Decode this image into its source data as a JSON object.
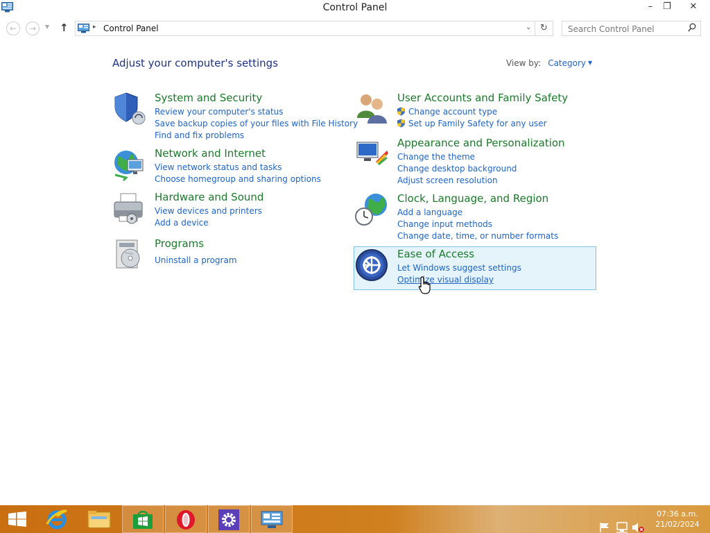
{
  "window": {
    "title": "Control Panel",
    "minimize": "–",
    "restore": "❐",
    "close": "✕"
  },
  "nav": {
    "back": "←",
    "forward": "→",
    "up": "↑",
    "breadcrumb_arrow": "▸",
    "breadcrumb": "Control Panel",
    "address_dropdown": "⌄",
    "refresh": "↻",
    "search_placeholder": "Search Control Panel"
  },
  "content": {
    "heading": "Adjust your computer's settings",
    "view_by_label": "View by:",
    "view_by_value": "Category",
    "categories": [
      {
        "title": "System and Security",
        "icon": "shield-icon",
        "links": [
          "Review your computer's status",
          "Save backup copies of your files with File History",
          "Find and fix problems"
        ]
      },
      {
        "title": "Network and Internet",
        "icon": "network-globe-icon",
        "links": [
          "View network status and tasks",
          "Choose homegroup and sharing options"
        ]
      },
      {
        "title": "Hardware and Sound",
        "icon": "printer-icon",
        "links": [
          "View devices and printers",
          "Add a device"
        ]
      },
      {
        "title": "Programs",
        "icon": "programs-disc-icon",
        "links": [
          "Uninstall a program"
        ]
      },
      {
        "title": "User Accounts and Family Safety",
        "icon": "users-icon",
        "links": [
          "Change account type",
          "Set up Family Safety for any user"
        ]
      },
      {
        "title": "Appearance and Personalization",
        "icon": "monitor-paint-icon",
        "links": [
          "Change the theme",
          "Change desktop background",
          "Adjust screen resolution"
        ]
      },
      {
        "title": "Clock, Language, and Region",
        "icon": "clock-globe-icon",
        "links": [
          "Add a language",
          "Change input methods",
          "Change date, time, or number formats"
        ]
      },
      {
        "title": "Ease of Access",
        "icon": "ease-of-access-icon",
        "links": [
          "Let Windows suggest settings",
          "Optimize visual display"
        ]
      }
    ]
  },
  "taskbar": {
    "apps": [
      "start-icon",
      "internet-explorer-icon",
      "file-explorer-icon",
      "store-icon",
      "opera-icon",
      "settings-gear-icon",
      "control-panel-icon"
    ],
    "time": "07:36 a.m.",
    "date": "21/02/2024"
  },
  "colors": {
    "category_title": "#1a7a2a",
    "link": "#1e64c8",
    "heading": "#1e3287",
    "taskbar": "#c96f12",
    "hover_bg": "#e5f3fb"
  }
}
